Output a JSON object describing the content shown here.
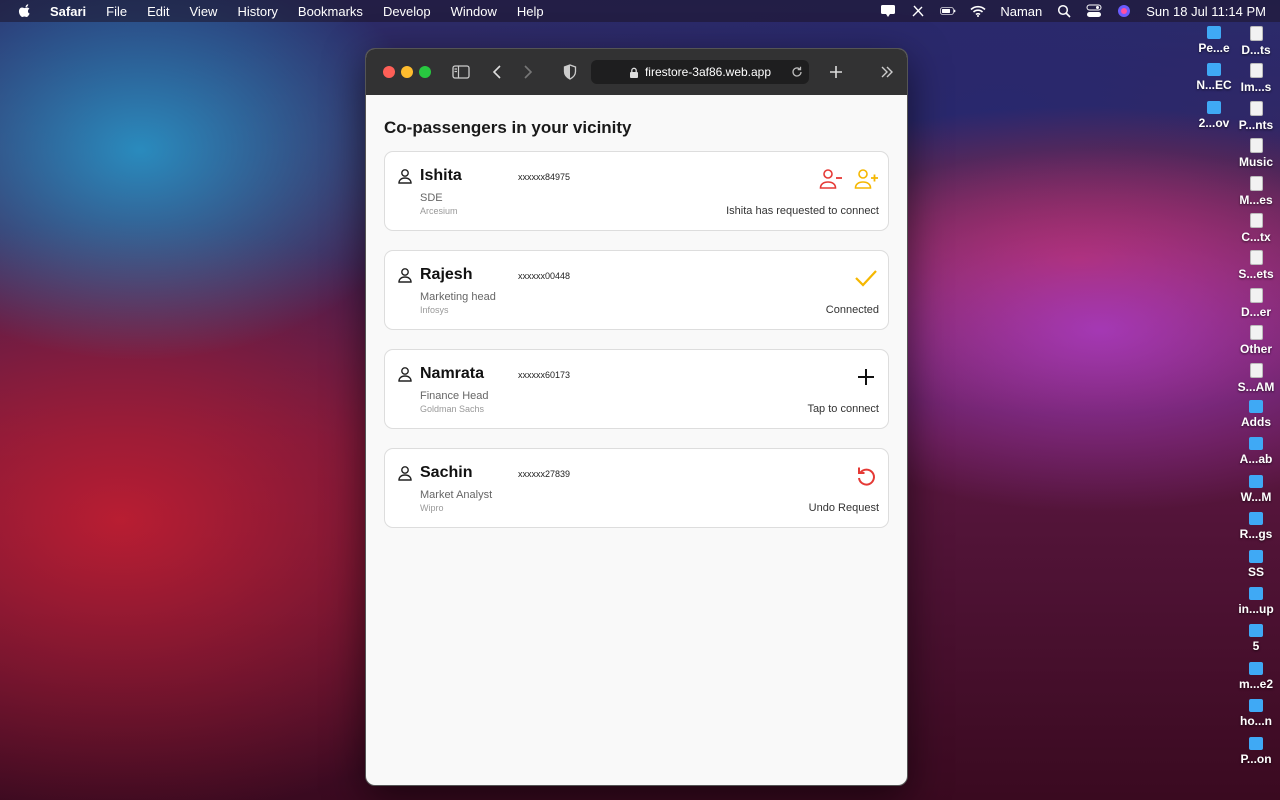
{
  "menubar": {
    "app_name": "Safari",
    "items": [
      "File",
      "Edit",
      "View",
      "History",
      "Bookmarks",
      "Develop",
      "Window",
      "Help"
    ],
    "user": "Naman",
    "datetime": "Sun 18 Jul  11:14 PM"
  },
  "desktop_icons": [
    {
      "label": "Pe...e",
      "kind": "folder"
    },
    {
      "label": "D...ts",
      "kind": "file"
    },
    {
      "label": "N...EC",
      "kind": "folder"
    },
    {
      "label": "Im...s",
      "kind": "file"
    },
    {
      "label": "2...ov",
      "kind": "folder"
    },
    {
      "label": "P...nts",
      "kind": "file"
    },
    {
      "label": "Music",
      "kind": "file"
    },
    {
      "label": "M...es",
      "kind": "file"
    },
    {
      "label": "C...tx",
      "kind": "file"
    },
    {
      "label": "S...ets",
      "kind": "file"
    },
    {
      "label": "D...er",
      "kind": "file"
    },
    {
      "label": "Other",
      "kind": "file"
    },
    {
      "label": "S...AM",
      "kind": "file"
    },
    {
      "label": "Adds",
      "kind": "folder"
    },
    {
      "label": "A...ab",
      "kind": "folder"
    },
    {
      "label": "W...M",
      "kind": "folder"
    },
    {
      "label": "R...gs",
      "kind": "folder"
    },
    {
      "label": "SS",
      "kind": "folder"
    },
    {
      "label": "in...up",
      "kind": "folder"
    },
    {
      "label": "5",
      "kind": "folder"
    },
    {
      "label": "m...e2",
      "kind": "folder"
    },
    {
      "label": "ho...n",
      "kind": "folder"
    },
    {
      "label": "P...on",
      "kind": "folder"
    }
  ],
  "browser": {
    "url": "firestore-3af86.web.app"
  },
  "page": {
    "title": "Co-passengers in your vicinity",
    "passengers": [
      {
        "name": "Ishita",
        "phone": "xxxxxx84975",
        "role": "SDE",
        "company": "Arcesium",
        "status": "Ishita has requested to connect",
        "action": "accept-reject",
        "reject_color": "#e53935",
        "accept_color": "#f5b700"
      },
      {
        "name": "Rajesh",
        "phone": "xxxxxx00448",
        "role": "Marketing head",
        "company": "Infosys",
        "status": "Connected",
        "action": "check",
        "icon_color": "#f5b700"
      },
      {
        "name": "Namrata",
        "phone": "xxxxxx60173",
        "role": "Finance Head",
        "company": "Goldman Sachs",
        "status": "Tap to connect",
        "action": "add",
        "icon_color": "#111111"
      },
      {
        "name": "Sachin",
        "phone": "xxxxxx27839",
        "role": "Market Analyst",
        "company": "Wipro",
        "status": "Undo Request",
        "action": "undo",
        "icon_color": "#e53935"
      }
    ]
  }
}
